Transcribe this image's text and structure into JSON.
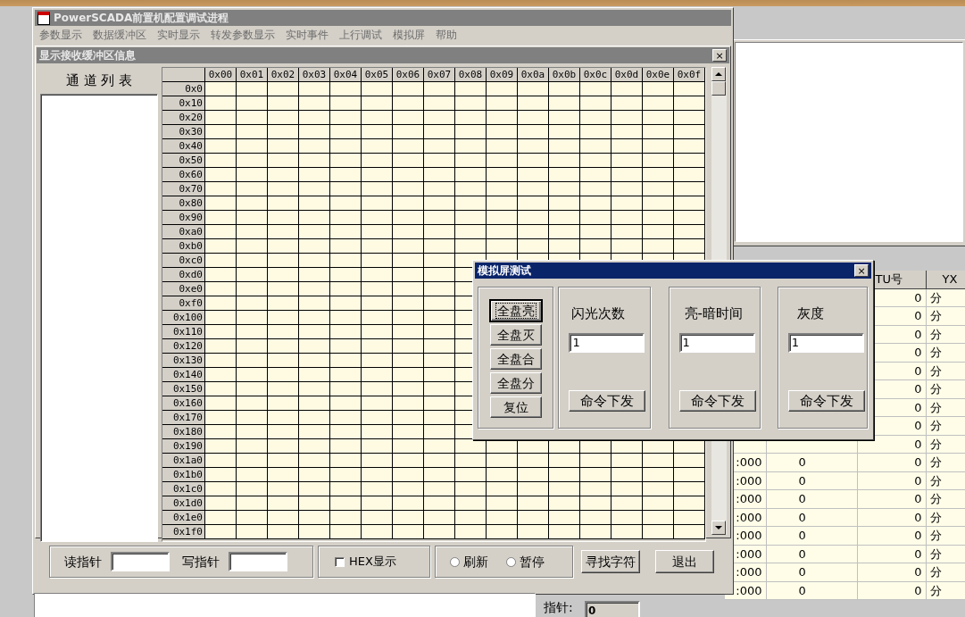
{
  "app_title": "PowerSCADA前置机配置调试进程",
  "menu": [
    "参数显示",
    "数据缓冲区",
    "实时显示",
    "转发参数显示",
    "实时事件",
    "上行调试",
    "模拟屏",
    "帮助"
  ],
  "buffer_window": {
    "title": "显示接收缓冲区信息",
    "close_glyph": "×",
    "channel_list_title": "通 道 列 表",
    "grid": {
      "columns": [
        "0x00",
        "0x01",
        "0x02",
        "0x03",
        "0x04",
        "0x05",
        "0x06",
        "0x07",
        "0x08",
        "0x09",
        "0x0a",
        "0x0b",
        "0x0c",
        "0x0d",
        "0x0e",
        "0x0f"
      ],
      "rows": [
        "0x0",
        "0x10",
        "0x20",
        "0x30",
        "0x40",
        "0x50",
        "0x60",
        "0x70",
        "0x80",
        "0x90",
        "0xa0",
        "0xb0",
        "0xc0",
        "0xd0",
        "0xe0",
        "0xf0",
        "0x100",
        "0x110",
        "0x120",
        "0x130",
        "0x140",
        "0x150",
        "0x160",
        "0x170",
        "0x180",
        "0x190",
        "0x1a0",
        "0x1b0",
        "0x1c0",
        "0x1d0",
        "0x1e0",
        "0x1f0"
      ]
    },
    "read_pointer_label": "读指针",
    "write_pointer_label": "写指针",
    "hex_checkbox": {
      "label": "HEX显示",
      "checked": false
    },
    "radios": [
      {
        "label": "刷新",
        "selected": false
      },
      {
        "label": "暂停",
        "selected": false
      }
    ],
    "buttons": [
      "寻找字符",
      "退出"
    ]
  },
  "pointer": {
    "label": "指针:",
    "value": "0"
  },
  "events_table": {
    "columns": [
      "TU号",
      "YX"
    ],
    "rows": [
      {
        "rtu": "0",
        "yx": "分"
      },
      {
        "rtu": "0",
        "yx": "分"
      },
      {
        "rtu": "0",
        "yx": "分"
      },
      {
        "rtu": "0",
        "yx": "分"
      },
      {
        "rtu": "0",
        "yx": "分"
      },
      {
        "rtu": "0",
        "yx": "分"
      },
      {
        "rtu": "0",
        "yx": "分"
      },
      {
        "rtu": "0",
        "yx": "分"
      },
      {
        "rtu": "0",
        "yx": "分"
      },
      {
        "column_1": ":000",
        "column_2": "0",
        "rtu": "0",
        "yx": "分"
      },
      {
        "column_1": ":000",
        "column_2": "0",
        "rtu": "0",
        "yx": "分"
      },
      {
        "column_1": ":000",
        "column_2": "0",
        "rtu": "0",
        "yx": "分"
      },
      {
        "column_1": ":000",
        "column_2": "0",
        "rtu": "0",
        "yx": "分"
      },
      {
        "column_1": ":000",
        "column_2": "0",
        "rtu": "0",
        "yx": "分"
      },
      {
        "column_1": ":000",
        "column_2": "0",
        "rtu": "0",
        "yx": "分"
      },
      {
        "column_1": ":000",
        "column_2": "0",
        "rtu": "0",
        "yx": "分"
      },
      {
        "column_1": ":000",
        "column_2": "0",
        "rtu": "0",
        "yx": "分"
      }
    ]
  },
  "dialog": {
    "title": "模拟屏测试",
    "close_glyph": "×",
    "panel_buttons": [
      {
        "label": "全盘亮",
        "focused": true
      },
      {
        "label": "全盘灭",
        "focused": false
      },
      {
        "label": "全盘合",
        "focused": false
      },
      {
        "label": "全盘分",
        "focused": false
      },
      {
        "label": "复位",
        "focused": false
      }
    ],
    "settings": [
      {
        "label": "闪光次数",
        "value": "1",
        "button": "命令下发"
      },
      {
        "label": "亮-暗时间",
        "value": "1",
        "button": "命令下发"
      },
      {
        "label": "灰度",
        "value": "1",
        "button": "命令下发"
      }
    ]
  }
}
